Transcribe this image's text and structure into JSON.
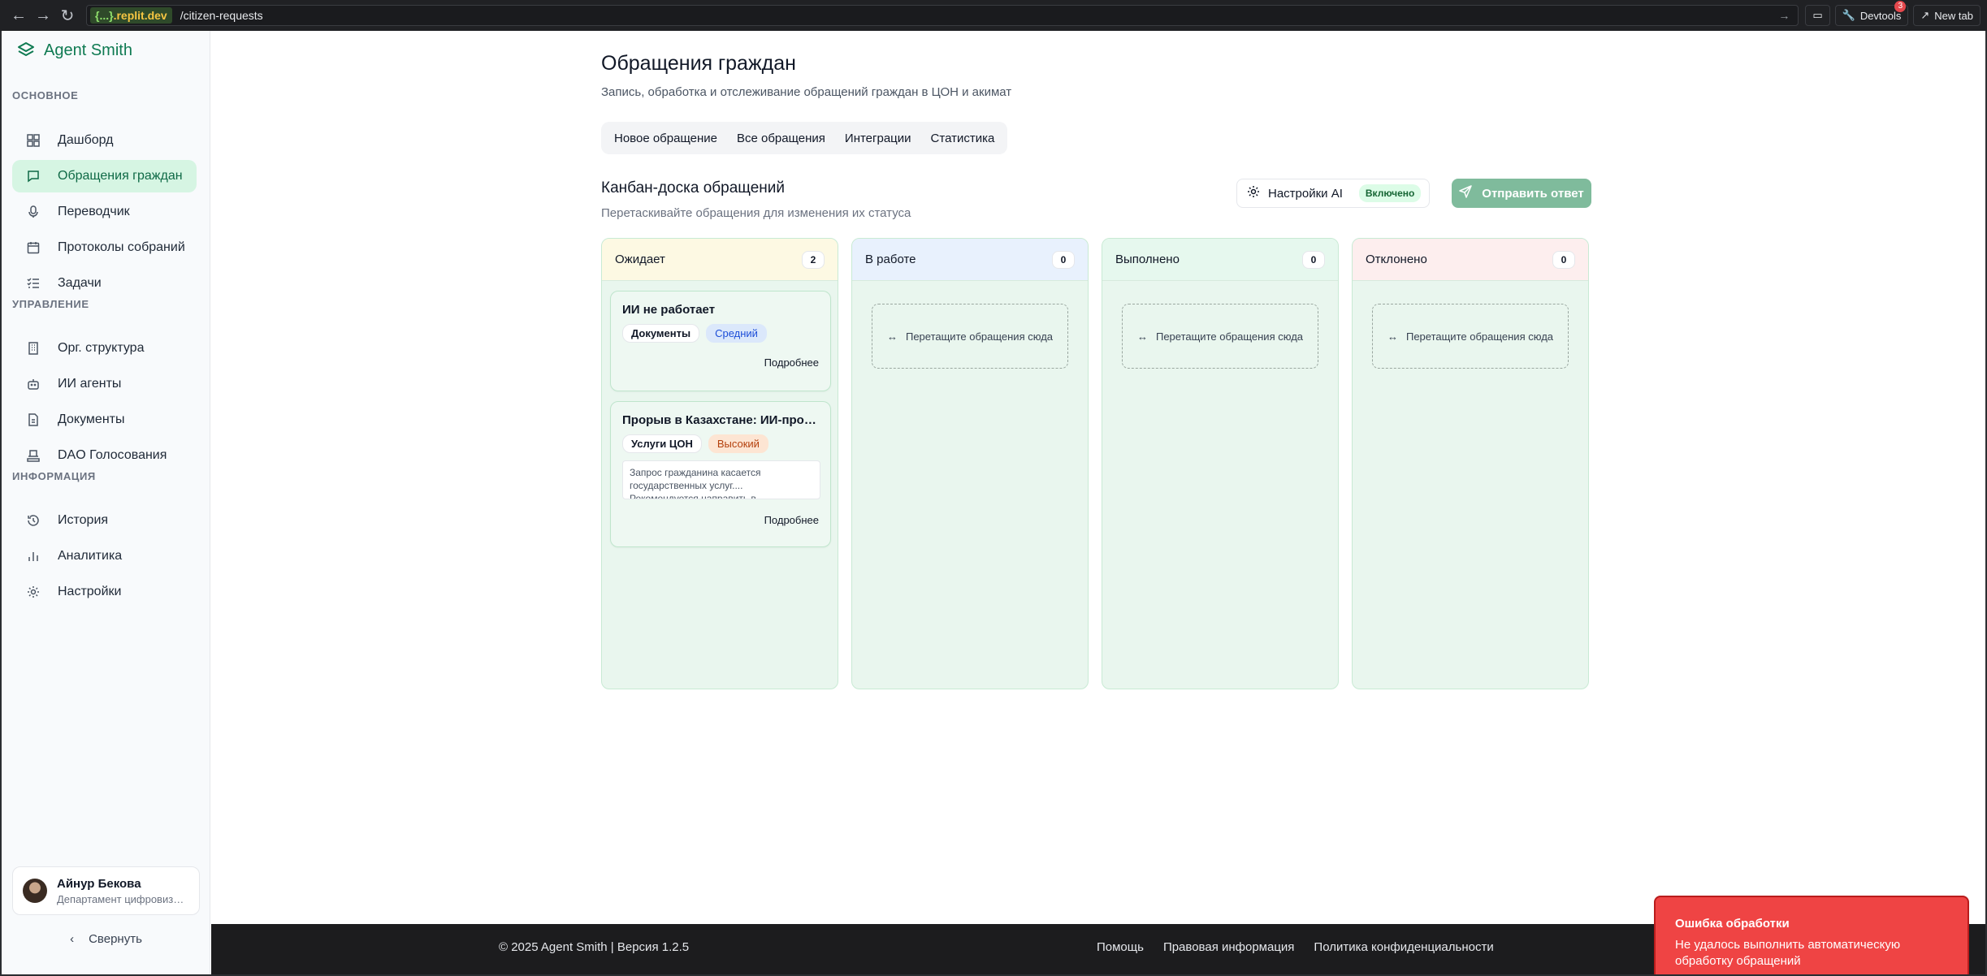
{
  "browser": {
    "host_prefix": "{...}",
    "host": ".replit.dev",
    "path": "/citizen-requests",
    "devtools_label": "Devtools",
    "devtools_badge": "3",
    "new_tab_label": "New tab"
  },
  "sidebar": {
    "brand": "Agent Smith",
    "sections": {
      "main": "ОСНОВНОЕ",
      "management": "УПРАВЛЕНИЕ",
      "info": "ИНФОРМАЦИЯ"
    },
    "items": [
      {
        "label": "Дашборд",
        "icon": "dashboard-icon"
      },
      {
        "label": "Обращения граждан",
        "icon": "message-icon",
        "active": true
      },
      {
        "label": "Переводчик",
        "icon": "mic-icon"
      },
      {
        "label": "Протоколы собраний",
        "icon": "calendar-icon"
      },
      {
        "label": "Задачи",
        "icon": "tasks-icon"
      },
      {
        "label": "Орг. структура",
        "icon": "building-icon"
      },
      {
        "label": "ИИ агенты",
        "icon": "bot-icon"
      },
      {
        "label": "Документы",
        "icon": "document-icon"
      },
      {
        "label": "DAO Голосования",
        "icon": "vote-icon"
      },
      {
        "label": "История",
        "icon": "history-icon"
      },
      {
        "label": "Аналитика",
        "icon": "chart-icon"
      },
      {
        "label": "Настройки",
        "icon": "gear-icon"
      }
    ],
    "user": {
      "name": "Айнур Бекова",
      "department": "Департамент цифровизации"
    },
    "collapse_label": "Свернуть"
  },
  "main": {
    "title": "Обращения граждан",
    "subtitle": "Запись, обработка и отслеживание обращений граждан в ЦОН и акимат",
    "tabs": [
      "Новое обращение",
      "Все обращения",
      "Интеграции",
      "Статистика"
    ],
    "kanban": {
      "title": "Канбан-доска обращений",
      "subtitle": "Перетаскивайте обращения для изменения их статуса",
      "ai_settings_label": "Настройки AI",
      "ai_status": "Включено",
      "send_label": "Отправить ответ",
      "dropzone_label": "Перетащите обращения сюда",
      "columns": [
        {
          "title": "Ожидает",
          "count": "2"
        },
        {
          "title": "В работе",
          "count": "0"
        },
        {
          "title": "Выполнено",
          "count": "0"
        },
        {
          "title": "Отклонено",
          "count": "0"
        }
      ],
      "cards": [
        {
          "title": "ИИ не работает",
          "category": "Документы",
          "priority": "Средний",
          "more": "Подробнее"
        },
        {
          "title": "Прорыв в Казахстане: ИИ-проект…",
          "category": "Услуги ЦОН",
          "priority": "Высокий",
          "description": "Запрос гражданина касается государственных услуг.... Рекомендуется направить в",
          "more": "Подробнее"
        }
      ]
    }
  },
  "footer": {
    "copyright": "© 2025 Agent Smith | Версия 1.2.5",
    "links": [
      "Помощь",
      "Правовая информация",
      "Политика конфиденциальности"
    ]
  },
  "toast": {
    "title": "Ошибка обработки",
    "message": "Не удалось выполнить автоматическую обработку обращений"
  },
  "colors": {
    "brand": "#0f7a52",
    "active_bg": "#d6f5e3",
    "send_button": "#7fbb9c",
    "toast_bg": "#ef4444"
  }
}
